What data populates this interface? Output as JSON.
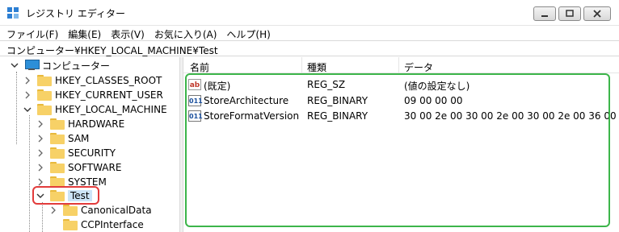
{
  "window": {
    "title": "レジストリ エディター"
  },
  "menu": [
    "ファイル(F)",
    "編集(E)",
    "表示(V)",
    "お気に入り(A)",
    "ヘルプ(H)"
  ],
  "address": "コンピューター¥HKEY_LOCAL_MACHINE¥Test",
  "tree": {
    "root": "コンピューター",
    "hives": [
      "HKEY_CLASSES_ROOT",
      "HKEY_CURRENT_USER",
      "HKEY_LOCAL_MACHINE"
    ],
    "hklm_children": [
      "HARDWARE",
      "SAM",
      "SECURITY",
      "SOFTWARE",
      "SYSTEM",
      "Test"
    ],
    "test_children": [
      "CanonicalData",
      "CCPInterface"
    ]
  },
  "list": {
    "headers": [
      "名前",
      "種類",
      "データ"
    ],
    "rows": [
      {
        "icon": "string-value-icon",
        "name": "(既定)",
        "type": "REG_SZ",
        "data": "(値の設定なし)"
      },
      {
        "icon": "binary-value-icon",
        "name": "StoreArchitecture",
        "type": "REG_BINARY",
        "data": "09 00 00 00"
      },
      {
        "icon": "binary-value-icon",
        "name": "StoreFormatVersion",
        "type": "REG_BINARY",
        "data": "30 00 2e 00 30 00 2e 00 30 00 2e 00 36 00"
      }
    ]
  },
  "colors": {
    "selection": "#cce4f7",
    "tree_annotation": "#e23b3b",
    "list_annotation": "#3cb54a",
    "folder": "#f7d167"
  }
}
